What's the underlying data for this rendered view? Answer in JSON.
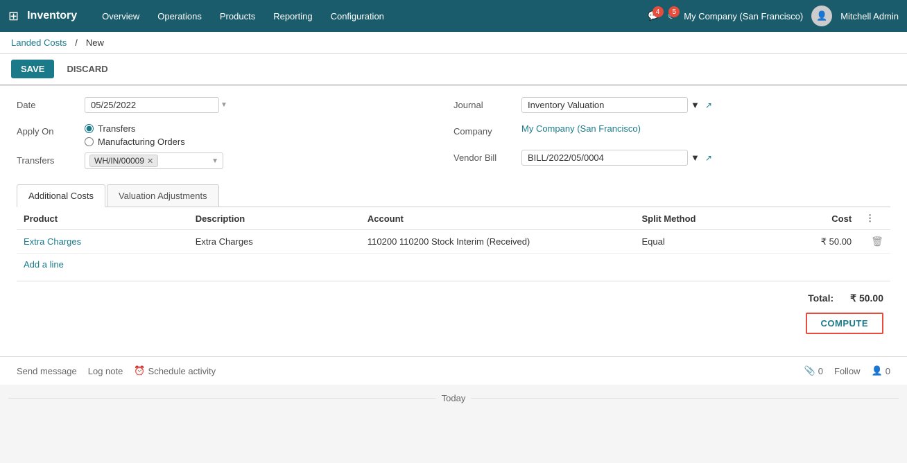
{
  "app": {
    "name": "Inventory",
    "nav_links": [
      "Overview",
      "Operations",
      "Products",
      "Reporting",
      "Configuration"
    ]
  },
  "header": {
    "notifications_count": "4",
    "activities_count": "5",
    "company": "My Company (San Francisco)",
    "user": "Mitchell Admin"
  },
  "breadcrumb": {
    "parent": "Landed Costs",
    "separator": "/",
    "current": "New"
  },
  "actions": {
    "save": "SAVE",
    "discard": "DISCARD"
  },
  "form": {
    "date_label": "Date",
    "date_value": "05/25/2022",
    "apply_on_label": "Apply On",
    "apply_on_option1": "Transfers",
    "apply_on_option2": "Manufacturing Orders",
    "transfers_label": "Transfers",
    "transfer_tag": "WH/IN/00009",
    "journal_label": "Journal",
    "journal_value": "Inventory Valuation",
    "company_label": "Company",
    "company_value": "My Company (San Francisco)",
    "vendor_bill_label": "Vendor Bill",
    "vendor_bill_value": "BILL/2022/05/0004"
  },
  "tabs": {
    "tab1": "Additional Costs",
    "tab2": "Valuation Adjustments"
  },
  "table": {
    "col_product": "Product",
    "col_description": "Description",
    "col_account": "Account",
    "col_split_method": "Split Method",
    "col_cost": "Cost",
    "rows": [
      {
        "product": "Extra Charges",
        "description": "Extra Charges",
        "account": "110200 110200 Stock Interim (Received)",
        "split_method": "Equal",
        "cost": "₹ 50.00"
      }
    ],
    "add_line": "Add a line"
  },
  "total": {
    "label": "Total:",
    "value": "₹ 50.00"
  },
  "compute_btn": "COMPUTE",
  "footer": {
    "send_message": "Send message",
    "log_note": "Log note",
    "schedule_activity": "Schedule activity",
    "follow": "Follow",
    "attachments_count": "0",
    "followers_count": "0"
  },
  "today_label": "Today"
}
